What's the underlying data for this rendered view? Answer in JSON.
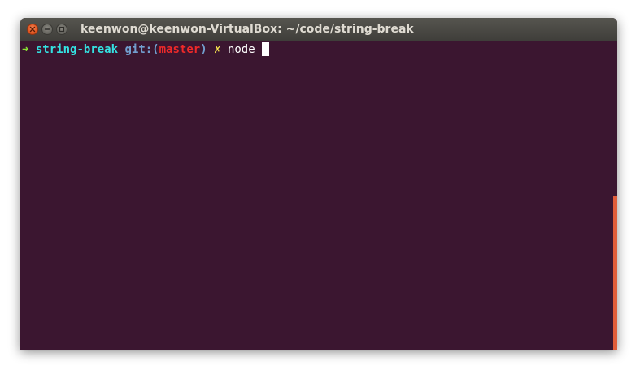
{
  "window": {
    "title": "keenwon@keenwon-VirtualBox: ~/code/string-break"
  },
  "prompt": {
    "arrow": "➜",
    "directory": "string-break",
    "git_prefix": "git:(",
    "branch": "master",
    "git_suffix": ")",
    "dirty_mark": "✗",
    "command": "node"
  },
  "colors": {
    "terminal_background": "#3b1630",
    "arrow": "#8ae234",
    "directory": "#34e2e2",
    "git": "#729fcf",
    "branch": "#ef2929",
    "dirty_mark": "#fce94f",
    "scrollbar": "#e05d3a"
  }
}
